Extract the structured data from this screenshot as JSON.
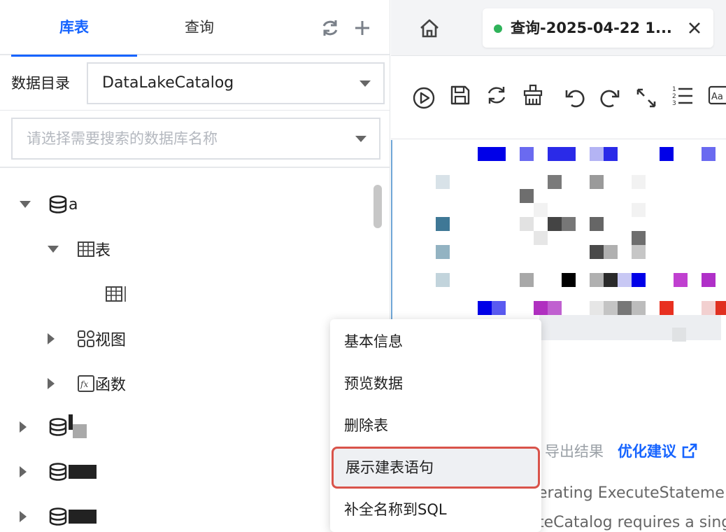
{
  "left": {
    "tabs": [
      {
        "label": "库表",
        "active": true
      },
      {
        "label": "查询",
        "active": false
      }
    ],
    "actions": [
      "refresh-icon",
      "plus-icon"
    ],
    "catalog": {
      "label": "数据目录",
      "value": "DataLakeCatalog"
    },
    "search": {
      "placeholder": "请选择需要搜索的数据库名称"
    },
    "tree": {
      "db_a": "a",
      "tables_folder": "表",
      "views_folder": "视图",
      "functions_folder": "函数"
    }
  },
  "right": {
    "query_tab": {
      "title": "查询-2025-04-22 1...",
      "status_color": "#2fb35a"
    },
    "toolbar": [
      "run-icon",
      "save-icon",
      "refresh-icon",
      "clean-icon",
      "undo-icon",
      "redo-icon",
      "expand-icon",
      "numbered-list-icon",
      "font-case-icon"
    ],
    "result": {
      "export": "导出结果",
      "optimize": "优化建议"
    },
    "log_lines": [
      "erating ExecuteStateme",
      "teCatalog requires a sing"
    ]
  },
  "context_menu": {
    "items": [
      {
        "label": "基本信息"
      },
      {
        "label": "预览数据"
      },
      {
        "label": "删除表"
      },
      {
        "label": "展示建表语句",
        "highlighted": true
      },
      {
        "label": "补全名称到SQL"
      }
    ]
  },
  "colors": {
    "accent": "#1664ff",
    "highlight_border": "#d9534a",
    "status_green": "#2fb35a"
  }
}
